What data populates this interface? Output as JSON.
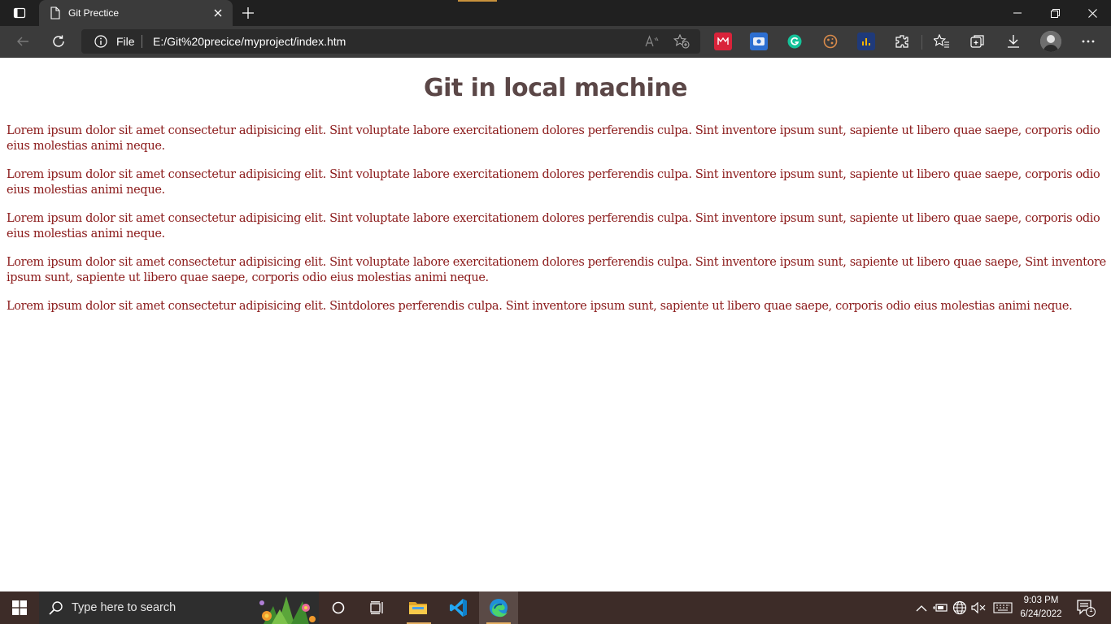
{
  "browser": {
    "tab_title": "Git Prectice",
    "address": {
      "scheme_label": "File",
      "url": "E:/Git%20precice/myproject/index.htm"
    }
  },
  "page": {
    "title": "Git in local machine",
    "paragraphs": [
      "Lorem ipsum dolor sit amet consectetur adipisicing elit. Sint voluptate labore exercitationem dolores perferendis culpa. Sint inventore ipsum sunt, sapiente ut libero quae saepe, corporis odio eius molestias animi neque.",
      "Lorem ipsum dolor sit amet consectetur adipisicing elit. Sint voluptate labore exercitationem dolores perferendis culpa. Sint inventore ipsum sunt, sapiente ut libero quae saepe, corporis odio eius molestias animi neque.",
      "Lorem ipsum dolor sit amet consectetur adipisicing elit. Sint voluptate labore exercitationem dolores perferendis culpa. Sint inventore ipsum sunt, sapiente ut libero quae saepe, corporis odio eius molestias animi neque.",
      "Lorem ipsum dolor sit amet consectetur adipisicing elit. Sint voluptate labore exercitationem dolores perferendis culpa. Sint inventore ipsum sunt, sapiente ut libero quae saepe, Sint inventore ipsum sunt, sapiente ut libero quae saepe, corporis odio eius molestias animi neque.",
      "Lorem ipsum dolor sit amet consectetur adipisicing elit. Sintdolores perferendis culpa. Sint inventore ipsum sunt, sapiente ut libero quae saepe, corporis odio eius molestias animi neque."
    ]
  },
  "taskbar": {
    "search_placeholder": "Type here to search",
    "time": "9:03 PM",
    "date": "6/24/2022",
    "notification_count": "1"
  },
  "colors": {
    "heading": "#5b4747",
    "paragraph": "#8b1a1a",
    "browser_chrome": "#3b3b3b",
    "taskbar": "#3d2c28"
  }
}
